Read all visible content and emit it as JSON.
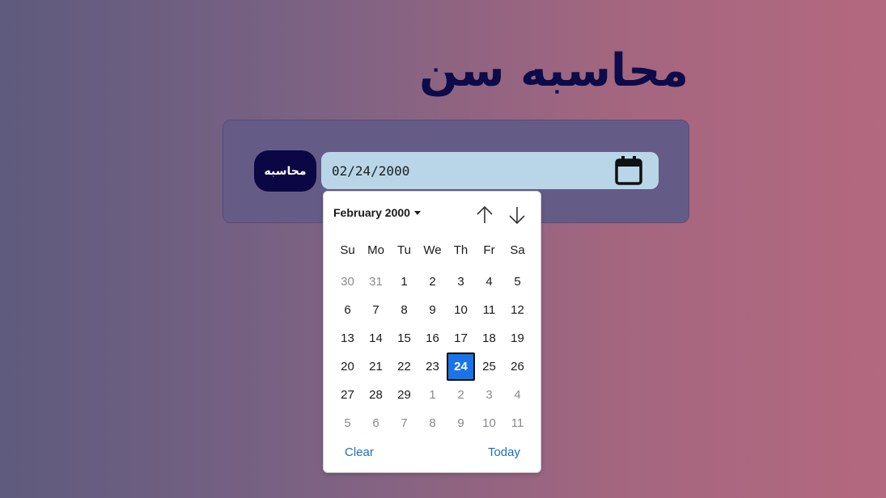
{
  "page": {
    "title": "محاسبه سن"
  },
  "form": {
    "calc_button_label": "محاسبه",
    "date_value": "02/24/2000",
    "calendar_icon": "calendar-icon"
  },
  "picker": {
    "month_label": "February 2000",
    "prev_icon": "arrow-up-icon",
    "next_icon": "arrow-down-icon",
    "weekdays": [
      "Su",
      "Mo",
      "Tu",
      "We",
      "Th",
      "Fr",
      "Sa"
    ],
    "days": [
      {
        "label": "30",
        "other": true
      },
      {
        "label": "31",
        "other": true
      },
      {
        "label": "1"
      },
      {
        "label": "2"
      },
      {
        "label": "3"
      },
      {
        "label": "4"
      },
      {
        "label": "5"
      },
      {
        "label": "6"
      },
      {
        "label": "7"
      },
      {
        "label": "8"
      },
      {
        "label": "9"
      },
      {
        "label": "10"
      },
      {
        "label": "11"
      },
      {
        "label": "12"
      },
      {
        "label": "13"
      },
      {
        "label": "14"
      },
      {
        "label": "15"
      },
      {
        "label": "16"
      },
      {
        "label": "17"
      },
      {
        "label": "18"
      },
      {
        "label": "19"
      },
      {
        "label": "20"
      },
      {
        "label": "21"
      },
      {
        "label": "22"
      },
      {
        "label": "23"
      },
      {
        "label": "24",
        "selected": true
      },
      {
        "label": "25"
      },
      {
        "label": "26"
      },
      {
        "label": "27"
      },
      {
        "label": "28"
      },
      {
        "label": "29"
      },
      {
        "label": "1",
        "other": true
      },
      {
        "label": "2",
        "other": true
      },
      {
        "label": "3",
        "other": true
      },
      {
        "label": "4",
        "other": true
      },
      {
        "label": "5",
        "other": true
      },
      {
        "label": "6",
        "other": true
      },
      {
        "label": "7",
        "other": true
      },
      {
        "label": "8",
        "other": true
      },
      {
        "label": "9",
        "other": true
      },
      {
        "label": "10",
        "other": true
      },
      {
        "label": "11",
        "other": true
      }
    ],
    "clear_label": "Clear",
    "today_label": "Today"
  },
  "colors": {
    "title": "#0d0b4a",
    "button_bg": "#0b0744",
    "input_bg": "#b8d6e8",
    "selected_day": "#1a73e8",
    "link": "#1a6fc4"
  }
}
